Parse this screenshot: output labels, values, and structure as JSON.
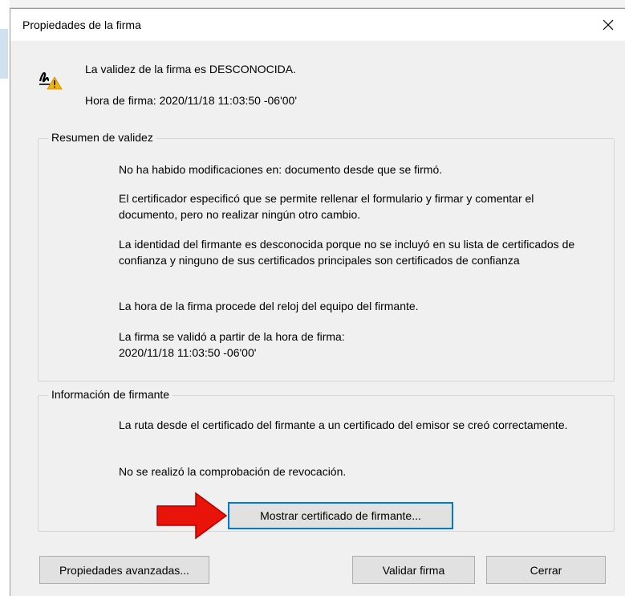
{
  "window": {
    "title": "Propiedades de la firma",
    "close_symbol": "✕"
  },
  "status": {
    "icon": "signature-warning-icon",
    "validity_text": "La validez de la firma es DESCONOCIDA.",
    "time_text": "Hora de firma:  2020/11/18 11:03:50 -06'00'"
  },
  "validity_summary": {
    "legend": "Resumen de validez",
    "paragraphs": [
      "No ha habido modificaciones en: documento desde que se firmó.",
      "El certificador especificó que se permite rellenar el formulario y firmar y comentar el documento, pero no realizar ningún otro cambio.",
      "La identidad del firmante es desconocida porque no se incluyó en su lista de certificados de confianza y ninguno de sus certificados principales son certificados de confianza",
      "La hora de la firma procede del reloj del equipo del firmante.",
      "La firma se validó a partir de la hora de firma:\n2020/11/18 11:03:50 -06'00'"
    ]
  },
  "signer_info": {
    "legend": "Información de firmante",
    "paragraphs": [
      "La ruta desde el certificado del firmante a un certificado del emisor se creó correctamente.",
      "No se realizó la comprobación de revocación."
    ],
    "show_cert_button": "Mostrar certificado de firmante..."
  },
  "footer": {
    "advanced_button": "Propiedades avanzadas...",
    "validate_button": "Validar firma",
    "close_button": "Cerrar"
  },
  "colors": {
    "dialog_bg": "#f0f0f0",
    "focus_border": "#0078d7",
    "arrow_red": "#e8140a",
    "warning_yellow": "#f5b400"
  }
}
